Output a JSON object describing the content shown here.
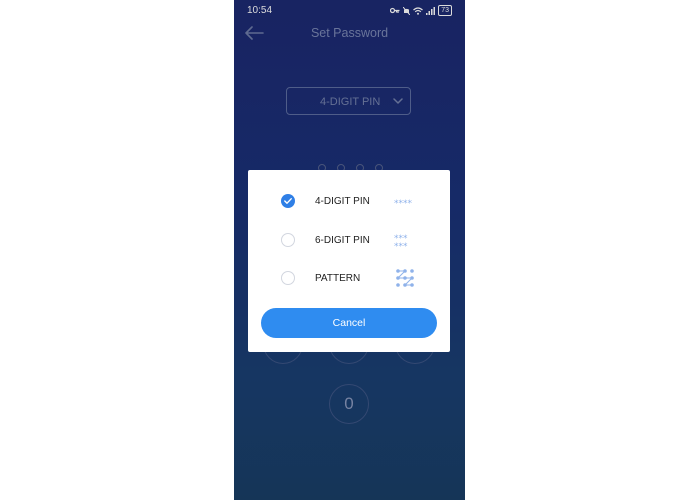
{
  "status_bar": {
    "time": "10:54",
    "battery": "73"
  },
  "header": {
    "title": "Set Password"
  },
  "type_select": {
    "value": "4-DIGIT PIN"
  },
  "pin_length_visible": 4,
  "keypad": {
    "visible_key": "0"
  },
  "dialog": {
    "options": [
      {
        "label": "4-DIGIT PIN",
        "selected": true,
        "icon": "four-stars-icon"
      },
      {
        "label": "6-DIGIT PIN",
        "selected": false,
        "icon": "six-stars-icon"
      },
      {
        "label": "PATTERN",
        "selected": false,
        "icon": "pattern-grid-icon"
      }
    ],
    "cancel_label": "Cancel"
  },
  "colors": {
    "accent": "#2f8cf0",
    "background_top": "#1d2a73",
    "background_bottom": "#193e66",
    "icon_blue": "#8fb2ea"
  }
}
